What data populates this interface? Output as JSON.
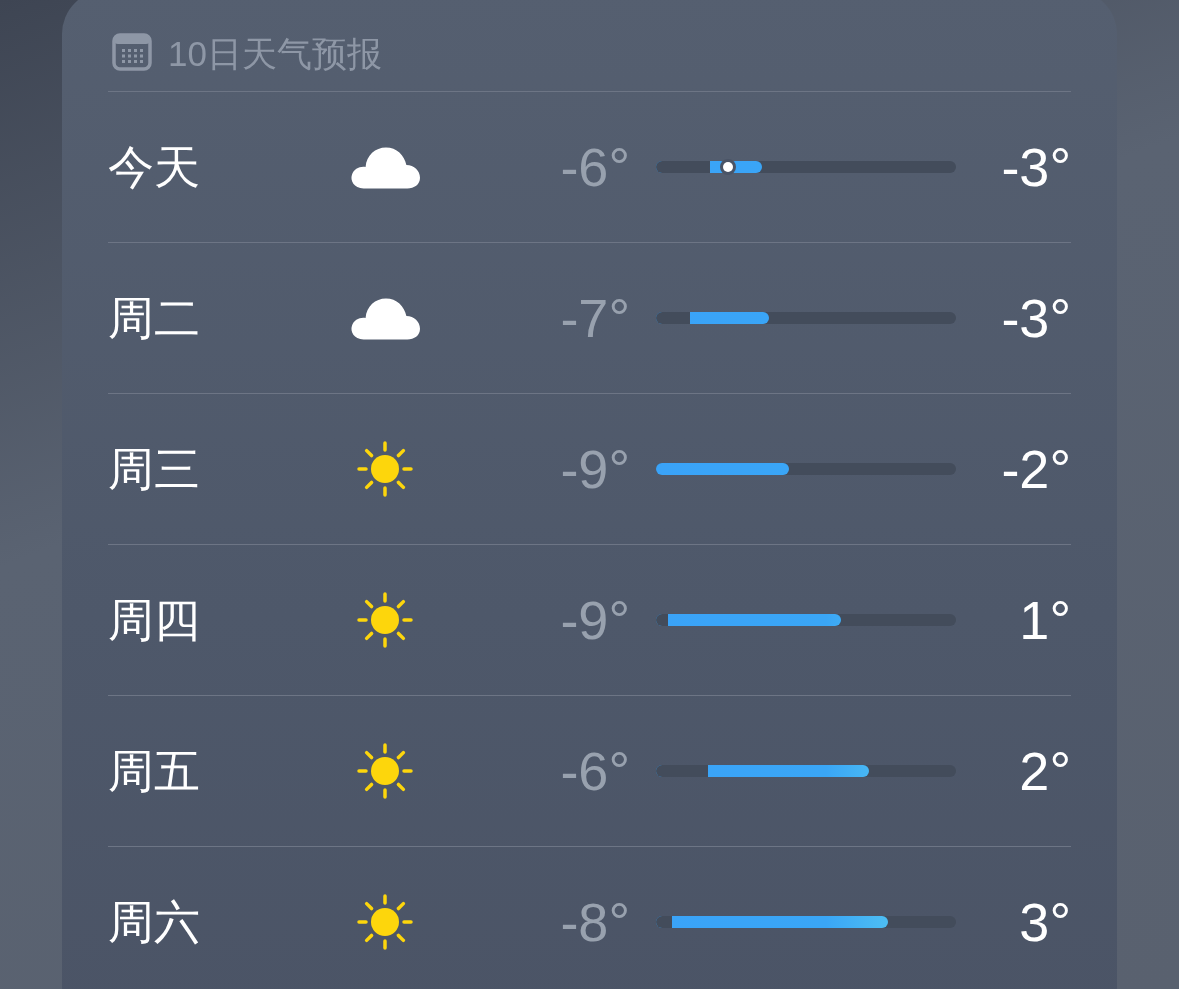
{
  "header": {
    "title": "10日天气预报"
  },
  "days": [
    {
      "label": "今天",
      "kind": "cloud",
      "low": "-6°",
      "high": "-3°",
      "bar": {
        "start": {
          "level": 0.18
        },
        "end": {
          "level": 0.353
        }
      },
      "current": {
        "level": 0.24
      }
    },
    {
      "label": "周二",
      "kind": "cloud",
      "low": "-7°",
      "high": "-3°",
      "bar": {
        "start": {
          "level": 0.113
        },
        "end": {
          "level": 0.377
        }
      }
    },
    {
      "label": "周三",
      "kind": "sun",
      "low": "-9°",
      "high": "-2°",
      "bar": {
        "start": {
          "level": 0.0
        },
        "end": {
          "level": 0.443
        }
      }
    },
    {
      "label": "周四",
      "kind": "sun",
      "low": "-9°",
      "high": "1°",
      "bar": {
        "start": {
          "level": 0.04
        },
        "end": {
          "level": 0.617
        }
      }
    },
    {
      "label": "周五",
      "kind": "sun",
      "low": "-6°",
      "high": "2°",
      "bar": {
        "start": {
          "level": 0.173
        },
        "end": {
          "level": 0.71
        }
      }
    },
    {
      "label": "周六",
      "kind": "sun",
      "low": "-8°",
      "high": "3°",
      "bar": {
        "start": {
          "level": 0.053
        },
        "end": {
          "level": 0.773
        }
      }
    }
  ]
}
